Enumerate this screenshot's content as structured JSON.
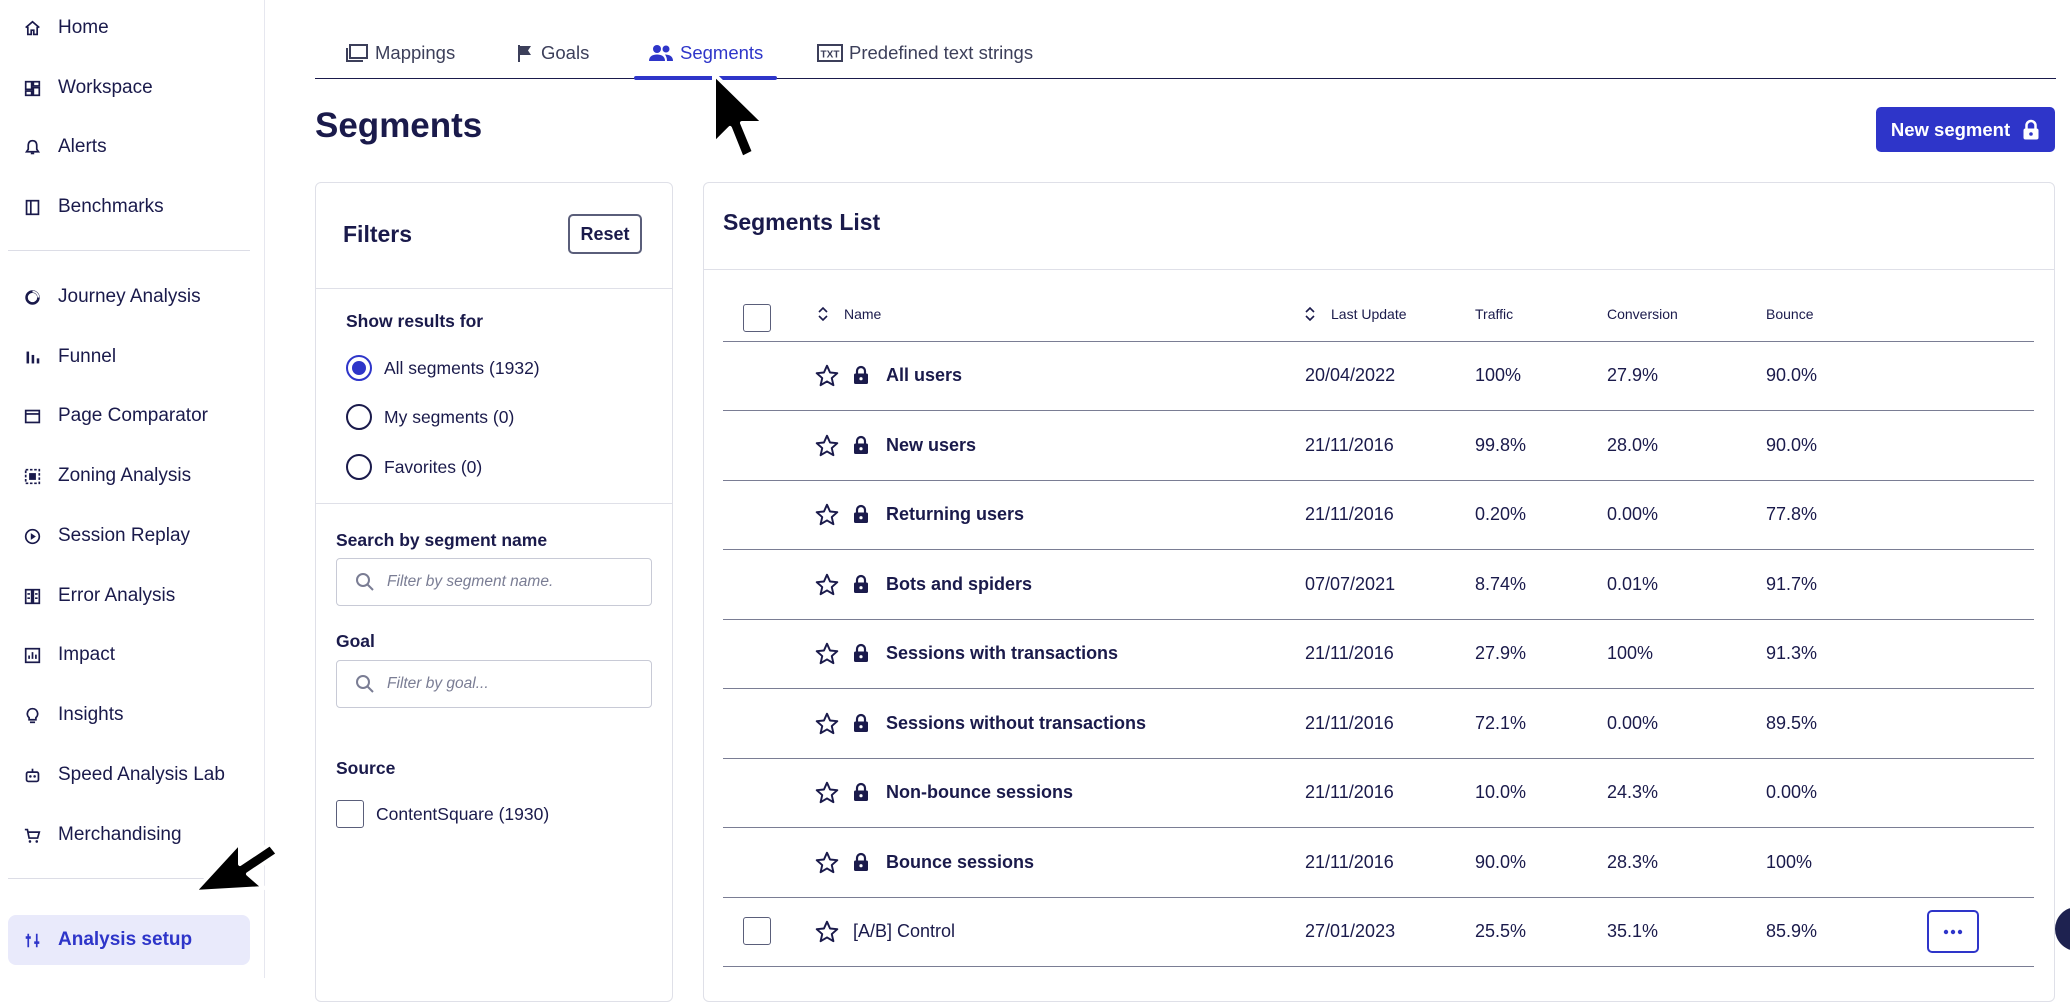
{
  "sidebar": {
    "items": [
      {
        "label": "Home",
        "icon": "home-icon"
      },
      {
        "label": "Workspace",
        "icon": "workspace-icon"
      },
      {
        "label": "Alerts",
        "icon": "bell-icon"
      },
      {
        "label": "Benchmarks",
        "icon": "book-icon"
      },
      {
        "label": "Journey Analysis",
        "icon": "journey-icon"
      },
      {
        "label": "Funnel",
        "icon": "funnel-icon"
      },
      {
        "label": "Page Comparator",
        "icon": "page-comparator-icon"
      },
      {
        "label": "Zoning Analysis",
        "icon": "zoning-icon"
      },
      {
        "label": "Session Replay",
        "icon": "play-icon"
      },
      {
        "label": "Error Analysis",
        "icon": "error-icon"
      },
      {
        "label": "Impact",
        "icon": "impact-chart-icon"
      },
      {
        "label": "Insights",
        "icon": "lightbulb-icon"
      },
      {
        "label": "Speed Analysis Lab",
        "icon": "robot-icon"
      },
      {
        "label": "Merchandising",
        "icon": "cart-icon"
      },
      {
        "label": "Analysis setup",
        "icon": "sliders-icon"
      }
    ]
  },
  "tabs": [
    {
      "label": "Mappings",
      "icon": "mappings-icon"
    },
    {
      "label": "Goals",
      "icon": "flag-icon"
    },
    {
      "label": "Segments",
      "icon": "users-icon"
    },
    {
      "label": "Predefined text strings",
      "icon": "txt-icon"
    }
  ],
  "header": {
    "title": "Segments",
    "new_button": "New segment"
  },
  "filters": {
    "title": "Filters",
    "reset": "Reset",
    "show_results_for": "Show results for",
    "options": [
      "All segments (1932)",
      "My segments (0)",
      "Favorites (0)"
    ],
    "selected_option": "All segments (1932)",
    "search_label": "Search by segment name",
    "search_placeholder": "Filter by segment name.",
    "goal_label": "Goal",
    "goal_placeholder": "Filter by goal...",
    "source_label": "Source",
    "source_option": "ContentSquare (1930)"
  },
  "segments_list": {
    "title": "Segments List",
    "columns": {
      "name": "Name",
      "last_update": "Last Update",
      "traffic": "Traffic",
      "conversion": "Conversion",
      "bounce": "Bounce"
    },
    "rows": [
      {
        "name": "All users",
        "last_update": "20/04/2022",
        "traffic": "100%",
        "conversion": "27.9%",
        "bounce": "90.0%"
      },
      {
        "name": "New users",
        "last_update": "21/11/2016",
        "traffic": "99.8%",
        "conversion": "28.0%",
        "bounce": "90.0%"
      },
      {
        "name": "Returning users",
        "last_update": "21/11/2016",
        "traffic": "0.20%",
        "conversion": "0.00%",
        "bounce": "77.8%"
      },
      {
        "name": "Bots and spiders",
        "last_update": "07/07/2021",
        "traffic": "8.74%",
        "conversion": "0.01%",
        "bounce": "91.7%"
      },
      {
        "name": "Sessions with transactions",
        "last_update": "21/11/2016",
        "traffic": "27.9%",
        "conversion": "100%",
        "bounce": "91.3%"
      },
      {
        "name": "Sessions without transactions",
        "last_update": "21/11/2016",
        "traffic": "72.1%",
        "conversion": "0.00%",
        "bounce": "89.5%"
      },
      {
        "name": "Non-bounce sessions",
        "last_update": "21/11/2016",
        "traffic": "10.0%",
        "conversion": "24.3%",
        "bounce": "0.00%"
      },
      {
        "name": "Bounce sessions",
        "last_update": "21/11/2016",
        "traffic": "90.0%",
        "conversion": "28.3%",
        "bounce": "100%"
      },
      {
        "name": "[A/B] Control",
        "last_update": "27/01/2023",
        "traffic": "25.5%",
        "conversion": "35.1%",
        "bounce": "85.9%"
      }
    ]
  },
  "colors": {
    "accent": "#2e35c9",
    "text": "#1a1a4b",
    "active_bg": "#e9eafb"
  }
}
